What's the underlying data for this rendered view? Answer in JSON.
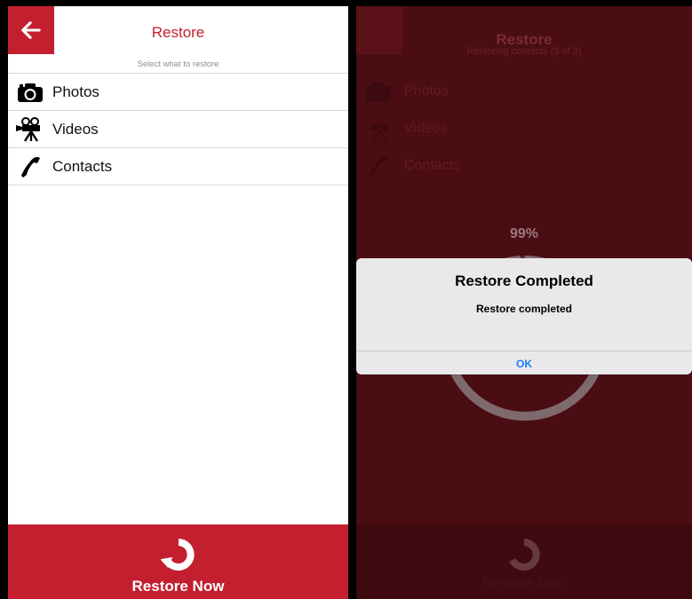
{
  "left": {
    "title": "Restore",
    "subtitle": "Select what to restore",
    "items": [
      {
        "label": "Photos",
        "icon": "camera-icon"
      },
      {
        "label": "Videos",
        "icon": "video-camera-icon"
      },
      {
        "label": "Contacts",
        "icon": "phone-icon"
      }
    ],
    "restore_button": "Restore Now",
    "colors": {
      "accent": "#c41f2f"
    }
  },
  "right": {
    "title": "Restore",
    "subtitle": "Restoring contacts (3 of 3)",
    "items": [
      {
        "label": "Photos"
      },
      {
        "label": "Videos"
      },
      {
        "label": "Contacts"
      }
    ],
    "progress_label": "99%",
    "progress": 0.99,
    "restore_button": "Restore Now",
    "alert": {
      "title": "Restore Completed",
      "message": "Restore completed",
      "ok": "OK"
    },
    "colors": {
      "dim_overlay": "#4a0d13",
      "link": "#1a7cf6"
    }
  }
}
